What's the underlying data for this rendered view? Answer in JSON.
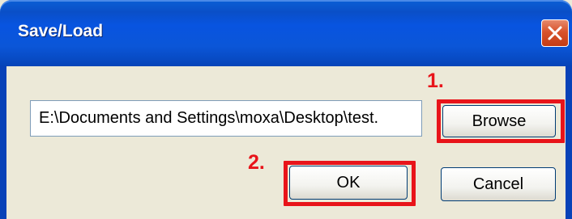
{
  "window": {
    "title": "Save/Load",
    "close_icon": "close-icon"
  },
  "form": {
    "path_value": "E:\\Documents and Settings\\moxa\\Desktop\\test.",
    "browse_label": "Browse",
    "ok_label": "OK",
    "cancel_label": "Cancel"
  },
  "annotations": {
    "step_1": "1.",
    "step_2": "2.",
    "highlight_color": "#e8141a"
  },
  "colors": {
    "titlebar": "#0a55d8",
    "dialog_background": "#ece9d8",
    "close_button": "#d8532b"
  }
}
